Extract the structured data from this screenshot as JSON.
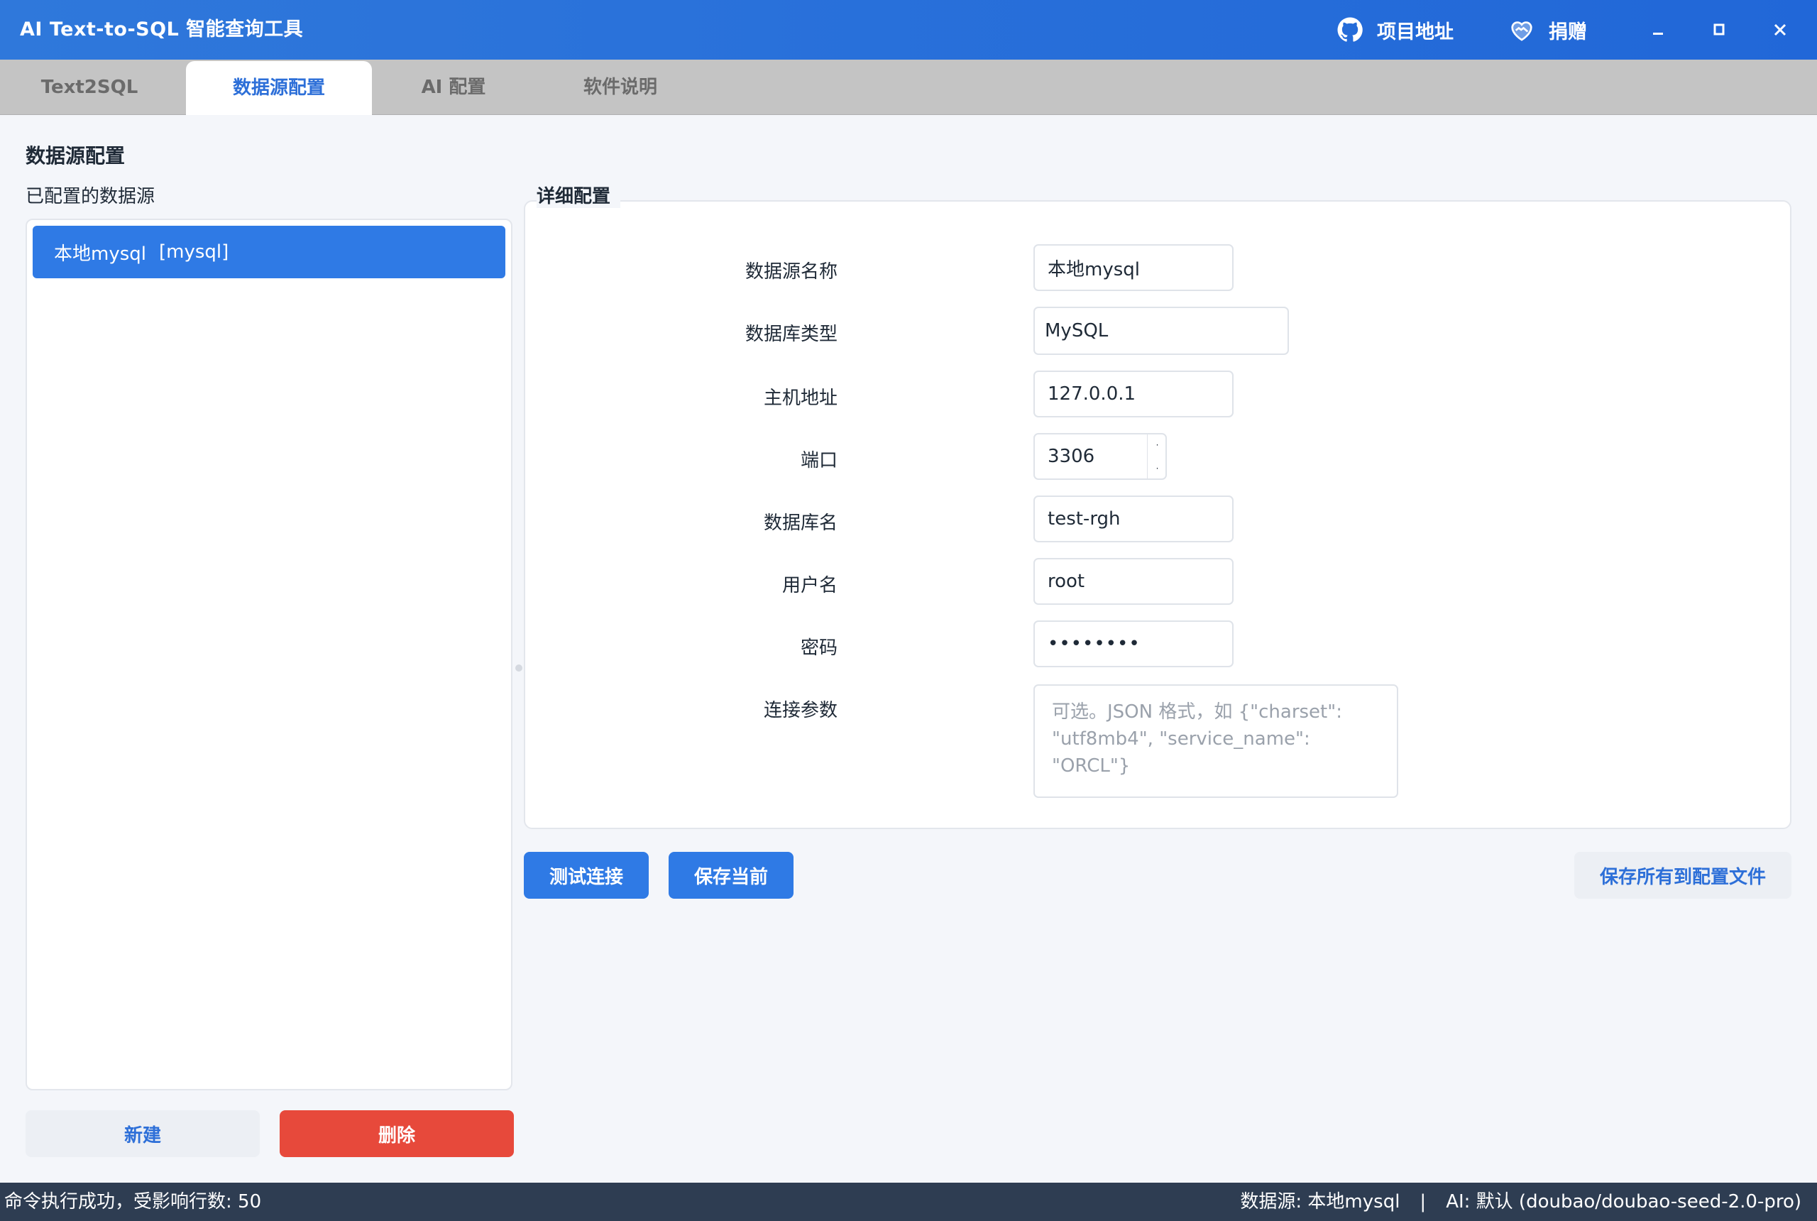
{
  "app": {
    "title": "AI Text-to-SQL 智能查询工具"
  },
  "titlebar": {
    "project_link": "项目地址",
    "donate_link": "捐赠"
  },
  "tabs": [
    "Text2SQL",
    "数据源配置",
    "AI 配置",
    "软件说明"
  ],
  "page": {
    "title": "数据源配置",
    "list_title": "已配置的数据源",
    "detail_title": "详细配置"
  },
  "datasources": [
    {
      "name": "本地mysql",
      "type": "[mysql]"
    }
  ],
  "form": {
    "name_label": "数据源名称",
    "name_value": "本地mysql",
    "dbtype_label": "数据库类型",
    "dbtype_value": "MySQL",
    "host_label": "主机地址",
    "host_value": "127.0.0.1",
    "port_label": "端口",
    "port_value": "3306",
    "dbname_label": "数据库名",
    "dbname_value": "test-rgh",
    "user_label": "用户名",
    "user_value": "root",
    "password_label": "密码",
    "password_value": "••••••••",
    "params_label": "连接参数",
    "params_placeholder": "可选。JSON 格式，如 {\"charset\": \"utf8mb4\", \"service_name\": \"ORCL\"}"
  },
  "buttons": {
    "new": "新建",
    "delete": "删除",
    "test": "测试连接",
    "save_current": "保存当前",
    "save_all": "保存所有到配置文件"
  },
  "status": {
    "left": "命令执行成功，受影响行数: 50",
    "datasource": "数据源: 本地mysql",
    "separator": "|",
    "ai": "AI: 默认 (doubao/doubao-seed-2.0-pro)"
  },
  "colors": {
    "accent": "#2f7ae5",
    "danger": "#e7493b",
    "titlebar": "#2167d8",
    "statusbar": "#2e3d52"
  }
}
